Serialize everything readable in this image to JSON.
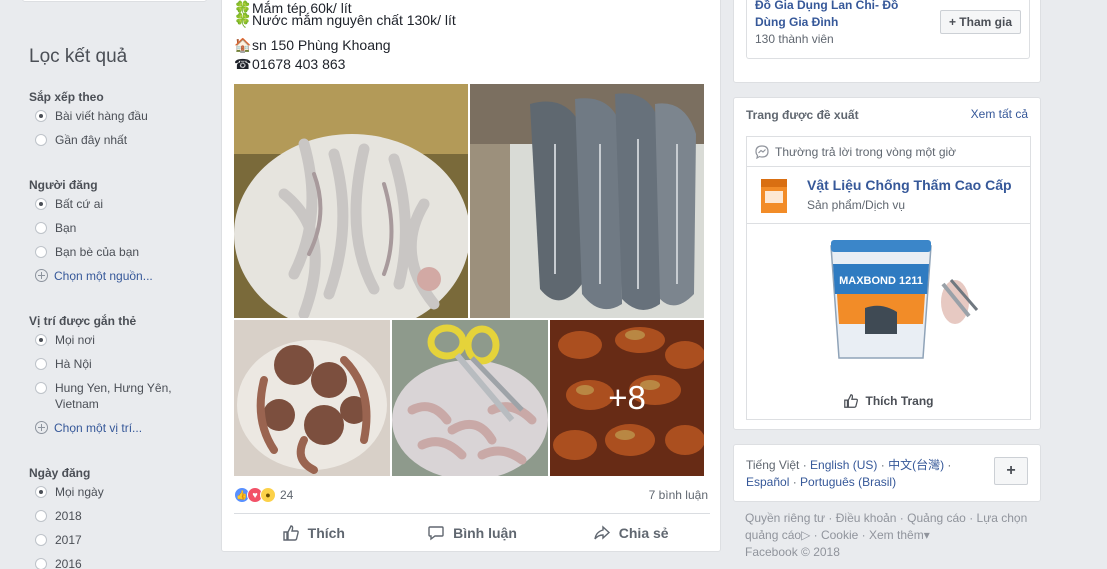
{
  "sidebar": {
    "title": "Lọc kết quả",
    "sections": [
      {
        "heading": "Sắp xếp theo",
        "options": [
          {
            "label": "Bài viết hàng đầu",
            "selected": true
          },
          {
            "label": "Gần đây nhất",
            "selected": false
          }
        ]
      },
      {
        "heading": "Người đăng",
        "options": [
          {
            "label": "Bất cứ ai",
            "selected": true
          },
          {
            "label": "Bạn",
            "selected": false
          },
          {
            "label": "Bạn bè của bạn",
            "selected": false
          }
        ],
        "link": "Chọn một nguồn..."
      },
      {
        "heading": "Vị trí được gắn thẻ",
        "options": [
          {
            "label": "Mọi nơi",
            "selected": true
          },
          {
            "label": "Hà Nội",
            "selected": false
          },
          {
            "label": "Hung Yen, Hưng Yên, Vietnam",
            "selected": false
          }
        ],
        "link": "Chọn một vị trí..."
      },
      {
        "heading": "Ngày đăng",
        "options": [
          {
            "label": "Mọi ngày",
            "selected": true
          },
          {
            "label": "2018",
            "selected": false
          },
          {
            "label": "2017",
            "selected": false
          },
          {
            "label": "2016",
            "selected": false
          }
        ]
      }
    ]
  },
  "post": {
    "line1": "Mắm tép 60k/ lít",
    "line2": "Nước mắm nguyên chất 130k/ lít",
    "address": "sn 150 Phùng Khoang",
    "phone": "01678 403 863",
    "more_photos": "+8",
    "reaction_count": "24",
    "comment_count": "7 bình luận",
    "actions": {
      "like": "Thích",
      "comment": "Bình luận",
      "share": "Chia sẻ"
    },
    "colors": {
      "like": "#5890ff",
      "love": "#f25268",
      "wow": "#fcd149"
    }
  },
  "group": {
    "name": "Đồ Gia Dụng Lan Chi- Đồ Dùng Gia Đình",
    "members": "130 thành viên",
    "join": "+ Tham gia"
  },
  "suggested_pages": {
    "title": "Trang được đề xuất",
    "see_all": "Xem tất cả",
    "response": "Thường trả lời trong vòng một giờ",
    "page_name": "Vật Liệu Chống Thấm Cao Cấp",
    "category": "Sản phẩm/Dịch vụ",
    "product_label": "MAXBOND 1211",
    "like_page": "Thích Trang"
  },
  "languages": {
    "current": "Tiếng Việt",
    "options": [
      "English (US)",
      "中文(台灣)",
      "Español",
      "Português (Brasil)"
    ],
    "add": "+"
  },
  "footer": {
    "links": [
      "Quyền riêng tư",
      "Điều khoản",
      "Quảng cáo",
      "Lựa chọn quảng cáo",
      "Cookie",
      "Xem thêm"
    ],
    "copyright": "Facebook © 2018"
  }
}
